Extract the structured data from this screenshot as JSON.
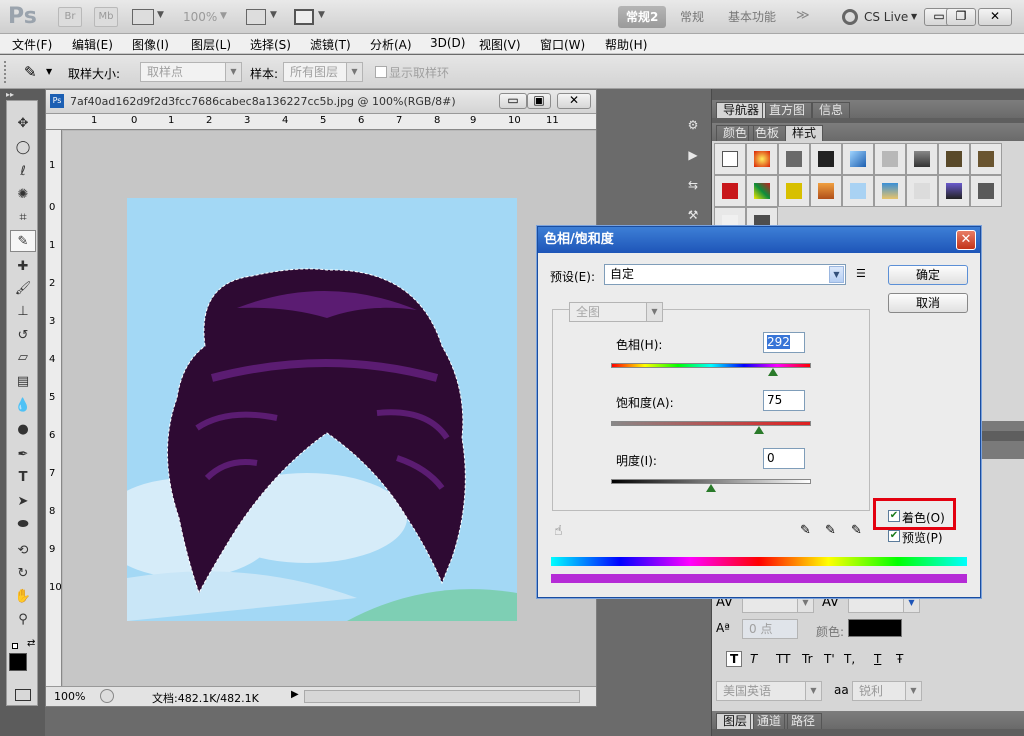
{
  "app": {
    "logo": "Ps",
    "br": "Br",
    "mb": "Mb",
    "zoom": "100%",
    "workspaces": [
      "常规2",
      "常规",
      "基本功能"
    ],
    "more": "≫",
    "cslive": "CS Live"
  },
  "menu": [
    "文件(F)",
    "编辑(E)",
    "图像(I)",
    "图层(L)",
    "选择(S)",
    "滤镜(T)",
    "分析(A)",
    "3D(D)",
    "视图(V)",
    "窗口(W)",
    "帮助(H)"
  ],
  "options": {
    "sample_size_label": "取样大小:",
    "sample_size_value": "取样点",
    "sample_label": "样本:",
    "sample_value": "所有图层",
    "show_ring": "显示取样环"
  },
  "document": {
    "title": "7af40ad162d9f2d3fcc7686cabec8a136227cc5b.jpg @ 100%(RGB/8#)",
    "ruler_h": [
      "1",
      "0",
      "1",
      "2",
      "3",
      "4",
      "5",
      "6",
      "7",
      "8",
      "9",
      "10",
      "11"
    ],
    "ruler_v": [
      "1",
      "0",
      "1",
      "2",
      "3",
      "4",
      "5",
      "6",
      "7",
      "8",
      "9",
      "10"
    ],
    "status_zoom": "100%",
    "status_doc": "文档:482.1K/482.1K"
  },
  "panels": {
    "tabs1": [
      "导航器",
      "直方图",
      "信息"
    ],
    "tabs2": [
      "颜色",
      "色板",
      "样式"
    ],
    "char_size": "0 点",
    "char_color_label": "颜色:",
    "char_lang": "美国英语",
    "char_aa": "锐利",
    "char_aa_icon": "aa",
    "char_styles": [
      "T",
      "T",
      "TT",
      "Tr",
      "T'",
      "T,",
      "T",
      "Ŧ"
    ],
    "tabs3": [
      "图层",
      "通道",
      "路径"
    ]
  },
  "dialog": {
    "title": "色相/饱和度",
    "preset_label": "预设(E):",
    "preset_value": "自定",
    "ok": "确定",
    "cancel": "取消",
    "channel": "全图",
    "hue_label": "色相(H):",
    "hue_value": "292",
    "sat_label": "饱和度(A):",
    "sat_value": "75",
    "light_label": "明度(I):",
    "light_value": "0",
    "colorize": "着色(O)",
    "preview": "预览(P)",
    "hue_fraction": 0.81,
    "sat_fraction": 0.74,
    "light_fraction": 0.5
  },
  "colors": {
    "sky": "#a3d8f5",
    "hair": "#2e0a33",
    "hair_highlight": "#5b1c72",
    "highlight_box": "#e3000f",
    "colorize_bar": "#b52bd6"
  }
}
